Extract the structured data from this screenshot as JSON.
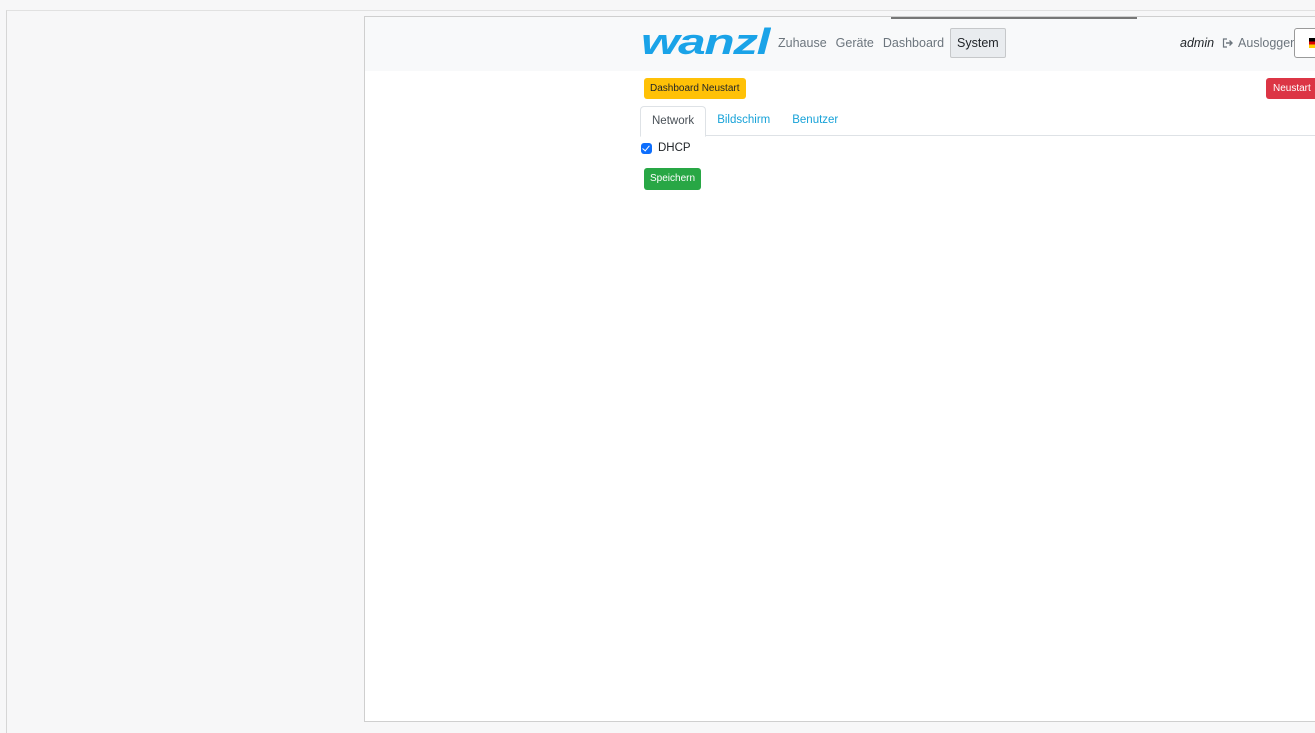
{
  "header": {
    "logo_text": "wanzl",
    "nav": [
      {
        "label": "Zuhause",
        "active": false
      },
      {
        "label": "Geräte",
        "active": false
      },
      {
        "label": "Dashboard",
        "active": false
      },
      {
        "label": "System",
        "active": true
      }
    ],
    "username": "admin",
    "logout_label": "Ausloggen",
    "logout_icon": "sign-out-icon",
    "language_icon": "german-flag-icon"
  },
  "actions": {
    "dashboard_restart_label": "Dashboard Neustart",
    "restart_label": "Neustart"
  },
  "tabs": [
    {
      "label": "Network",
      "active": true
    },
    {
      "label": "Bildschirm",
      "active": false
    },
    {
      "label": "Benutzer",
      "active": false
    }
  ],
  "network": {
    "dhcp_label": "DHCP",
    "dhcp_checked": true,
    "save_label": "Speichern"
  },
  "colors": {
    "logo": "#1aa3e8",
    "warning": "#ffc107",
    "danger": "#dc3545",
    "success": "#28a745",
    "link": "#17a2d8",
    "checkbox": "#0d6efd"
  }
}
